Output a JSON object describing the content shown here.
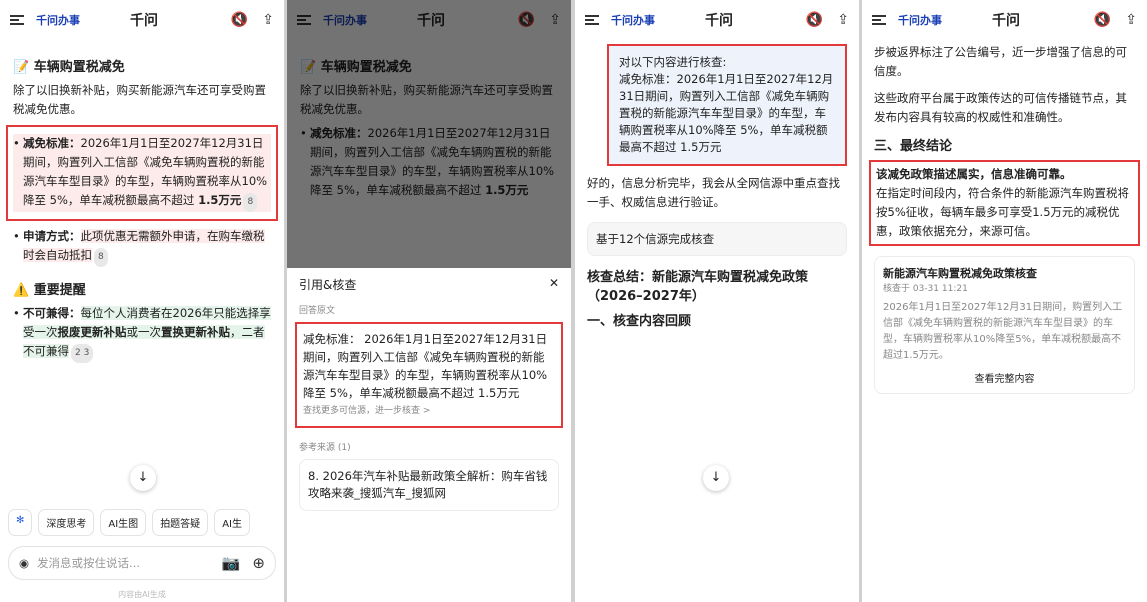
{
  "app": {
    "logo": "千问办事",
    "title": "千问",
    "title_chevron": "⌄"
  },
  "p1": {
    "heading": "📝 车辆购置税减免",
    "intro": "除了以旧换新补贴，购买新能源汽车还可享受购置税减免优惠。",
    "b1_label": "减免标准：",
    "b1_text": "2026年1月1日至2027年12月31日期间，购置列入工信部《减免车辆购置税的新能源汽车车型目录》的车型，车辆购置税率从10%降至 5%，单车减税额最高不超过",
    "b1_amt": "1.5万元",
    "b1_cite": "8",
    "b2_label": "申请方式：",
    "b2_text": "此项优惠无需额外申请，在购车缴税时会自动抵扣",
    "b2_cite": "8",
    "warn_heading": "⚠️ 重要提醒",
    "b3_label": "不可兼得：",
    "b3_text": "每位个人消费者在2026年只能选择享受一次",
    "b3_bold1": "报废更新补贴",
    "b3_mid": "或一次",
    "b3_bold2": "置换更新补贴",
    "b3_end": "，二者不可兼得",
    "b3_cites": "2 3"
  },
  "p2": {
    "sheet_title": "引用&核查",
    "orig_label": "回答原文",
    "orig_text": "减免标准： 2026年1月1日至2027年12月31日期间，购置列入工信部《减免车辆购置税的新能源汽车车型目录》的车型，车辆购置税率从10%降至 5%，单车减税额最高不超过 1.5万元",
    "more_link": "查找更多可信源，进一步核查 >",
    "refs_label": "参考来源 (1)",
    "ref_title": "8. 2026年汽车补贴最新政策全解析：购车省钱攻略来袭_搜狐汽车_搜狐网"
  },
  "p3": {
    "bubble": "对以下内容进行核查:\n减免标准：2026年1月1日至2027年12月31日期间，购置列入工信部《减免车辆购置税的新能源汽车车型目录》的车型，车辆购置税率从10%降至 5%，单车减税额最高不超过 1.5万元",
    "reply": "好的，信息分析完毕，我会从全网信源中重点查找一手、权威信息进行验证。",
    "sources_btn": "基于12个信源完成核查",
    "summary_title": "核查总结：新能源汽车购置税减免政策（2026–2027年）",
    "sec1": "一、核查内容回顾"
  },
  "p4": {
    "top_text": "步被返界标注了公告编号，近一步增强了信息的可信度。",
    "para": "这些政府平台属于政策传达的可信传播链节点，其发布内容具有较高的权威性和准确性。",
    "sec3": "三、最终结论",
    "concl_bold": "该减免政策描述属实，信息准确可靠。",
    "concl_text": "在指定时间段内，符合条件的新能源汽车购置税将按5%征收，每辆车最多可享受1.5万元的减税优惠，政策依据充分，来源可信。",
    "card_title": "新能源汽车购置税减免政策核查",
    "card_date": "核查于 03-31 11:21",
    "card_body": "2026年1月1日至2027年12月31日期间，购置列入工信部《减免车辆购置税的新能源汽车车型目录》的车型，车辆购置税率从10%降至5%，单车减税额最高不超过1.5万元。",
    "view_report": "查看完整内容"
  },
  "chips": {
    "deep": "深度思考",
    "ai_img": "AI生图",
    "photo": "拍题答疑",
    "ai_more": "AI生"
  },
  "input": {
    "placeholder": "发消息或按住说话..."
  },
  "footer": "内容由AI生成"
}
